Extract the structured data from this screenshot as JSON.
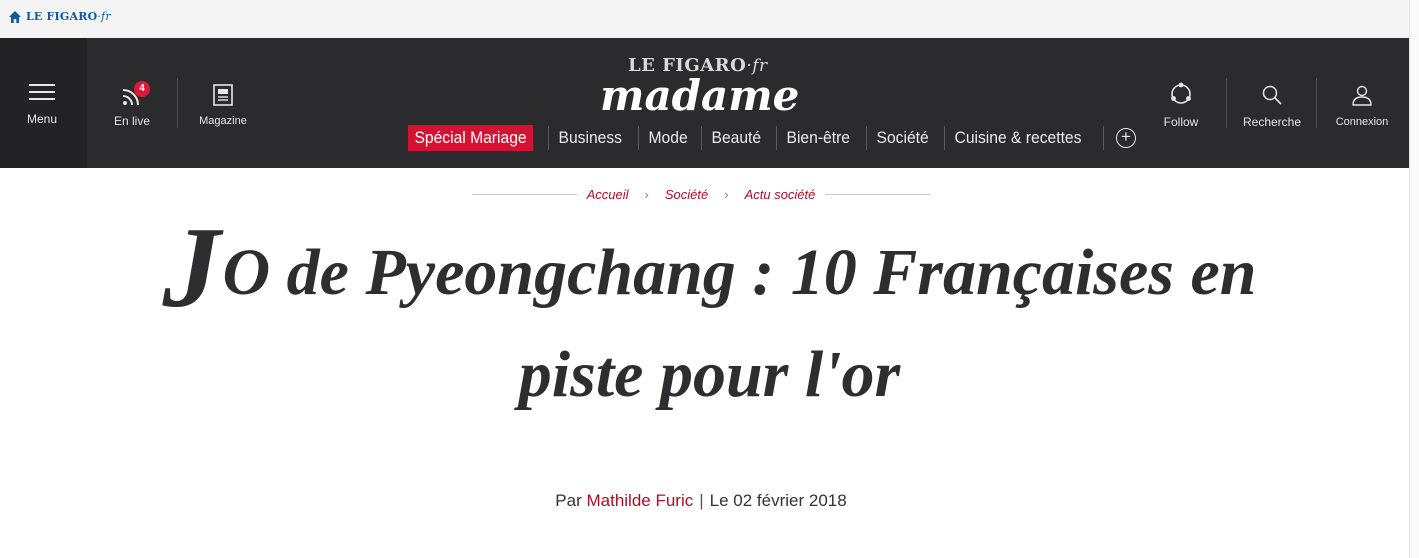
{
  "topbar": {
    "brand": "LE FIGARO",
    "brand_suffix": "·fr",
    "home_icon": "home-icon",
    "brand_color": "#0b5aa2"
  },
  "header": {
    "menu_label": "Menu",
    "live_label": "En live",
    "live_count": "4",
    "magazine_label": "Magazine",
    "logo_top": "LE FIGARO",
    "logo_top_suffix": "·fr",
    "logo_main": "madame",
    "nav": [
      {
        "label": "Spécial Mariage",
        "highlight": true
      },
      {
        "label": "Business"
      },
      {
        "label": "Mode"
      },
      {
        "label": "Beauté"
      },
      {
        "label": "Bien-être"
      },
      {
        "label": "Société"
      },
      {
        "label": "Cuisine & recettes"
      }
    ],
    "follow_label": "Follow",
    "search_label": "Recherche",
    "login_label": "Connexion",
    "background": "#2b2b2d",
    "accent": "#d41234"
  },
  "breadcrumb": {
    "items": [
      "Accueil",
      "Société",
      "Actu société"
    ],
    "color": "#a8102a"
  },
  "article": {
    "title_dropcap": "J",
    "title_rest": "O de Pyeongchang : 10 Françaises en piste pour l'or",
    "byline_prefix": "Par",
    "author": "Mathilde Furic",
    "date": "Le 02 février 2018"
  }
}
